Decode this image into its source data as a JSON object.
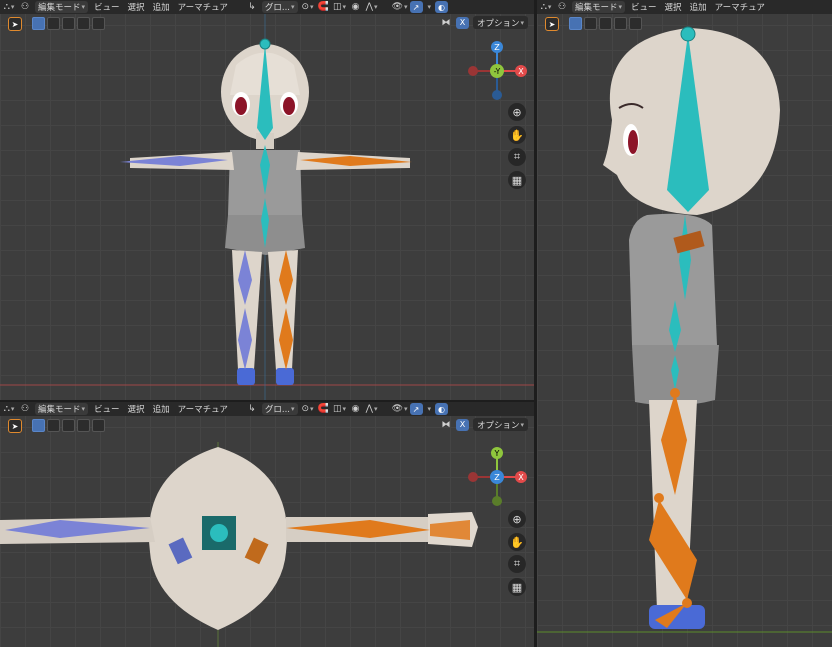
{
  "header": {
    "mode_label": "編集モード",
    "menu_view": "ビュー",
    "menu_select": "選択",
    "menu_add": "追加",
    "menu_armature": "アーマチュア",
    "orientation_label": "グロ...",
    "options_label": "オプション",
    "x_mirror_label": "X"
  },
  "side_header": {
    "mode_label": "編集モード",
    "menu_view": "ビュー",
    "menu_select": "選択",
    "menu_add": "追加",
    "menu_armature": "アーマチュア"
  },
  "gizmo": {
    "z_label": "Z",
    "y_label": "Y",
    "neg_y_label": "-Y",
    "x_label": "X"
  },
  "colors": {
    "viewport_bg": "#3d3d3d",
    "header_bg": "#282828",
    "accent_blue": "#4772b3",
    "bone_left": "#7b83d6",
    "bone_right": "#e07a1c",
    "bone_center": "#2bbdbd",
    "skin": "#ddd5cb",
    "shirt": "#9a9a9a",
    "shorts": "#8e8e8e",
    "axis_x": "#e24a4a",
    "axis_y": "#8fc63d",
    "axis_z": "#3a87d8"
  },
  "icons": {
    "editor_type": "armature-edit-icon",
    "select_tool": "cursor-icon",
    "zoom": "zoom-icon",
    "pan": "hand-icon",
    "camera": "camera-icon",
    "perspective": "grid-icon"
  }
}
